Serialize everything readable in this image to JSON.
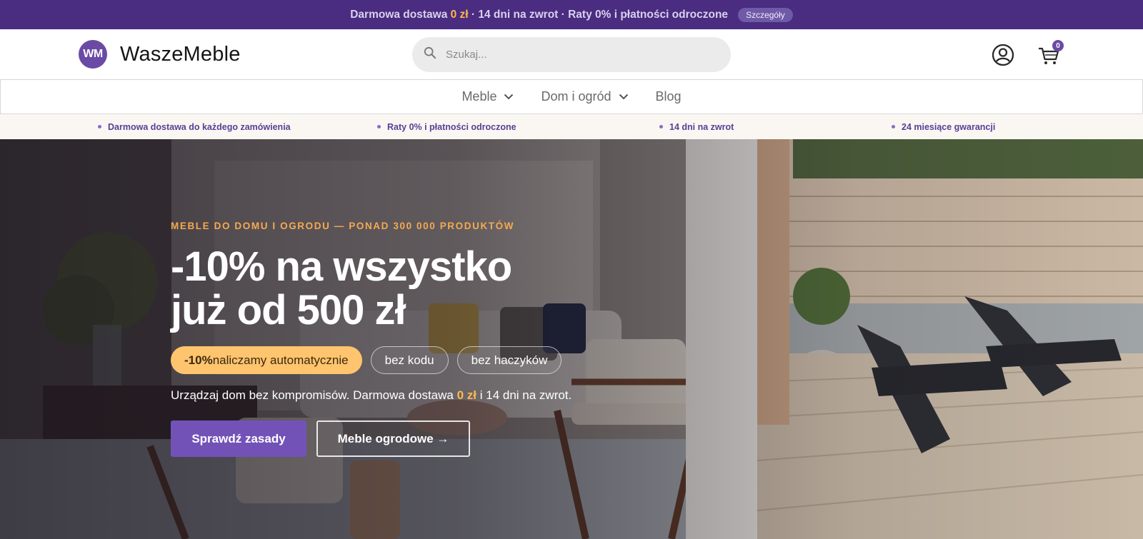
{
  "promo": {
    "text_before": "Darmowa dostawa ",
    "highlight": "0 zł",
    "text_after": " · 14 dni na zwrot · Raty 0% i płatności odroczone",
    "details_button": "Szczegóły"
  },
  "header": {
    "logo_badge": "WM",
    "logo_name": "WaszeMeble",
    "search_placeholder": "Szukaj...",
    "account_icon": "user-circle-icon",
    "cart_icon": "cart-icon",
    "cart_count": "0"
  },
  "nav": {
    "items": [
      {
        "label": "Meble",
        "has_dropdown": true
      },
      {
        "label": "Dom i ogród",
        "has_dropdown": true
      },
      {
        "label": "Blog",
        "has_dropdown": false
      }
    ]
  },
  "usp": [
    "Darmowa dostawa do każdego zamówienia",
    "Raty 0% i płatności odroczone",
    "14 dni na zwrot",
    "24 miesiące gwarancji"
  ],
  "hero": {
    "eyebrow": "MEBLE DO DOMU I OGRODU — PONAD 300 000 PRODUKTÓW",
    "headline_line1": "-10% na wszystko",
    "headline_line2": "już od 500 zł",
    "pill_accent_strong": "-10%",
    "pill_accent_rest": " naliczamy automatycznie",
    "pill_2": "bez kodu",
    "pill_3": "bez haczyków",
    "subcopy_before": "Urządzaj dom bez kompromisów. Darmowa dostawa ",
    "subcopy_highlight": "0 zł",
    "subcopy_after": " i 14 dni na zwrot.",
    "cta_primary": "Sprawdź zasady",
    "cta_secondary": "Meble ogrodowe →"
  },
  "colors": {
    "brand_purple": "#4a2c80",
    "accent_purple": "#7352b8",
    "accent_orange": "#ffb84d"
  }
}
